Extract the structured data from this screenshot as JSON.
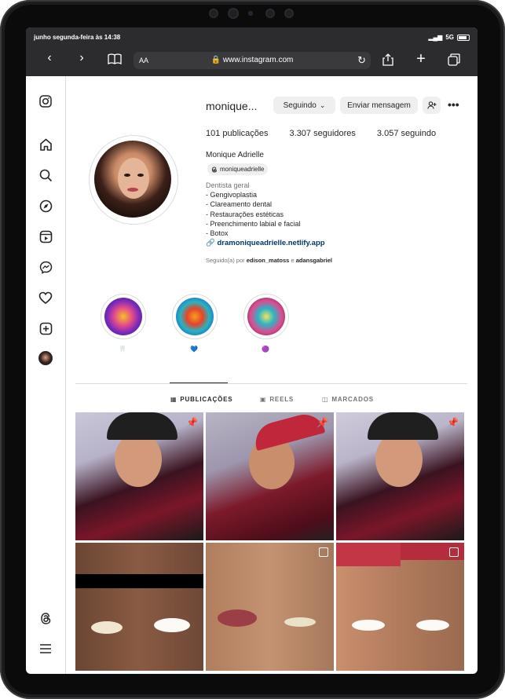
{
  "status_bar": {
    "datetime": "junho segunda-feira às 14:38",
    "signal": "5G"
  },
  "safari": {
    "text_size": "AA",
    "url": "www.instagram.com"
  },
  "sidebar": {
    "items": [
      "instagram-logo",
      "home",
      "search",
      "explore",
      "reels",
      "messages",
      "notifications",
      "create",
      "profile",
      "threads",
      "more"
    ]
  },
  "profile": {
    "username": "monique...",
    "following_button": "Seguindo",
    "message_button": "Enviar mensagem",
    "stats": {
      "posts": "101 publicações",
      "followers": "3.307 seguidores",
      "following": "3.057 seguindo"
    },
    "full_name": "Monique Adrielle",
    "threads_handle": "moniqueadrielle",
    "category": "Dentista geral",
    "bio_lines": [
      "- Gengivoplastia",
      "- Clareamento dental",
      "- Restaurações estéticas",
      "- Preenchimento labial e facial",
      "- Botox"
    ],
    "link": "dramoniqueadrielle.netlify.app",
    "followed_by_prefix": "Seguido(a) por",
    "followed_by_user1": "edison_matoss",
    "followed_by_sep": "e",
    "followed_by_user2": "adansgabriel"
  },
  "highlights": [
    {
      "label": "🦷",
      "color_a": "#e2498a",
      "color_b": "#2a1f6b"
    },
    {
      "label": "💙",
      "color_a": "#f0a21d",
      "color_b": "#1b6fd1"
    },
    {
      "label": "🟣",
      "color_a": "#29b6c8",
      "color_b": "#e04a8c"
    }
  ],
  "tabs": {
    "posts": "PUBLICAÇÕES",
    "reels": "REELS",
    "tagged": "MARCADOS"
  },
  "colors": {
    "accent_link": "#00376b",
    "text": "#262626",
    "muted": "#737373",
    "border": "#dbdbdb"
  }
}
